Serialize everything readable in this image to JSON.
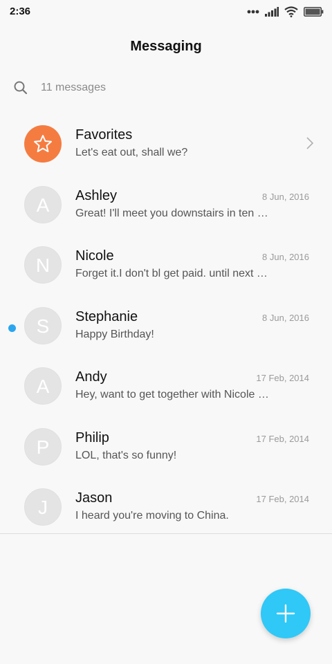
{
  "status_bar": {
    "time": "2:36",
    "icons": [
      "dots-icon",
      "signal-icon",
      "wifi-icon",
      "battery-icon"
    ]
  },
  "header": {
    "title": "Messaging"
  },
  "search": {
    "placeholder": "11 messages"
  },
  "conversations": [
    {
      "name": "Favorites",
      "preview": "Let's eat out, shall we?",
      "date": "",
      "avatar": "star-icon",
      "avatar_color": "#f57c41",
      "unread": false
    },
    {
      "name": "Ashley",
      "preview": "Great! I'll meet you downstairs in ten …",
      "date": "8 Jun, 2016",
      "avatar": "A",
      "unread": false
    },
    {
      "name": "Nicole",
      "preview": "Forget it.I don't bl get paid. until next F…",
      "date": "8 Jun, 2016",
      "avatar": "N",
      "unread": false
    },
    {
      "name": "Stephanie",
      "preview": "Happy Birthday!",
      "date": "8 Jun, 2016",
      "avatar": "S",
      "unread": true
    },
    {
      "name": "Andy",
      "preview": "Hey, want to get together with Nicole …",
      "date": "17 Feb, 2014",
      "avatar": "A",
      "unread": false
    },
    {
      "name": "Philip",
      "preview": "LOL, that's so funny!",
      "date": "17 Feb, 2014",
      "avatar": "P",
      "unread": false
    },
    {
      "name": "Jason",
      "preview": "I heard you're moving to China.",
      "date": "17 Feb, 2014",
      "avatar": "J",
      "unread": false
    }
  ],
  "fab": {
    "icon": "plus-icon",
    "color": "#2fc8f7"
  },
  "colors": {
    "accent": "#2fc8f7",
    "unread_dot": "#2ba6ee",
    "favorites": "#f57c41"
  }
}
